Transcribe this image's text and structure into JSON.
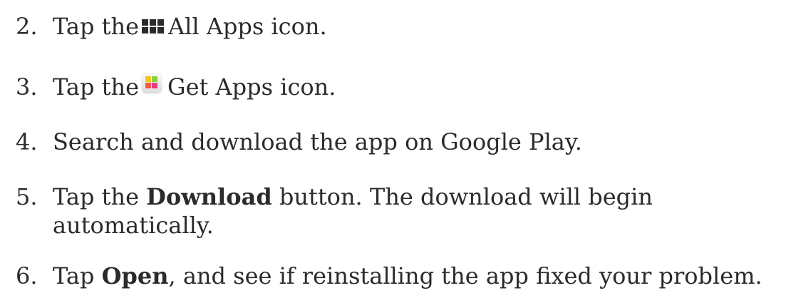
{
  "steps": [
    {
      "number": "2.",
      "before": "Tap the",
      "icon": "all-apps-grid-icon",
      "after": "All Apps icon."
    },
    {
      "number": "3.",
      "before": "Tap the",
      "icon": "get-apps-icon",
      "after": "Get Apps icon."
    },
    {
      "number": "4.",
      "text": "Search and download the app on Google Play."
    },
    {
      "number": "5.",
      "before": "Tap the",
      "bold": "Download",
      "after": "button. The download will begin",
      "continuation": "automatically."
    },
    {
      "number": "6.",
      "before": "Tap",
      "bold": "Open",
      "after": ", and see if reinstalling the app fixed your problem."
    }
  ],
  "colors": {
    "text": "#2b2b2b",
    "background": "#ffffff",
    "getapps_yellow": "#f2c61f",
    "getapps_green": "#8ccf3f",
    "getapps_red": "#f25a3d",
    "getapps_pink": "#e63c8f"
  }
}
